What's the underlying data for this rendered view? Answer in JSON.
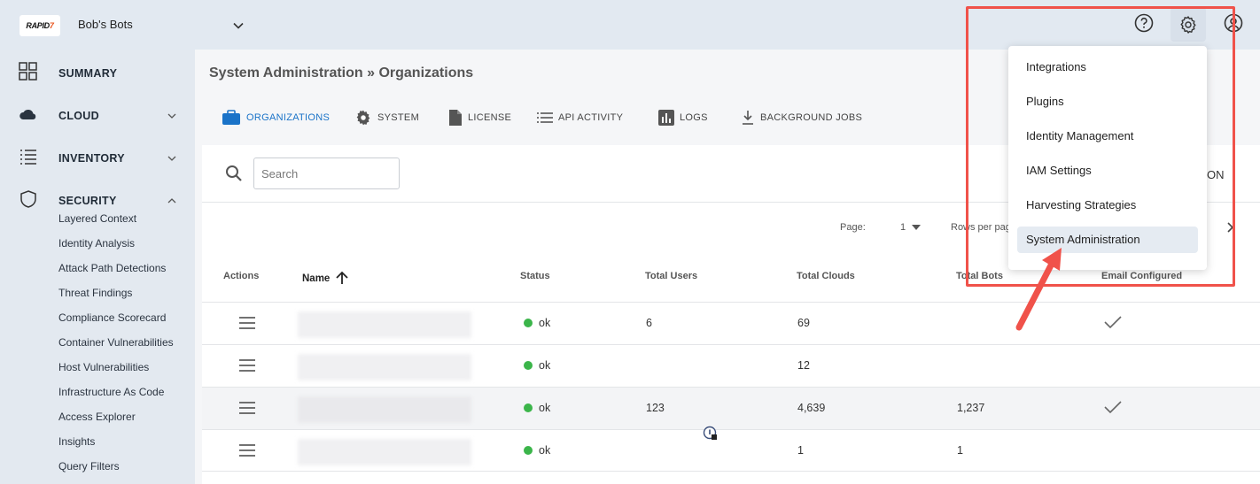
{
  "topbar": {
    "logo": {
      "prefix": "RAPID",
      "suffix": "7"
    },
    "org_name": "Bob's Bots"
  },
  "sidebar": {
    "items": [
      {
        "label": "SUMMARY"
      },
      {
        "label": "CLOUD"
      },
      {
        "label": "INVENTORY"
      },
      {
        "label": "SECURITY"
      }
    ],
    "security_subitems": [
      "Layered Context",
      "Identity Analysis",
      "Attack Path Detections",
      "Threat Findings",
      "Compliance Scorecard",
      "Container Vulnerabilities",
      "Host Vulnerabilities",
      "Infrastructure As Code",
      "Access Explorer",
      "Insights",
      "Query Filters"
    ]
  },
  "main": {
    "title": "System Administration » Organizations",
    "tabs": [
      {
        "label": "ORGANIZATIONS",
        "active": true
      },
      {
        "label": "SYSTEM"
      },
      {
        "label": "LICENSE"
      },
      {
        "label": "API ACTIVITY"
      },
      {
        "label": "LOGS"
      },
      {
        "label": "BACKGROUND JOBS"
      }
    ],
    "search": {
      "placeholder": "Search"
    },
    "toolbar_right_text": "ON",
    "pager": {
      "page_label": "Page:",
      "page_value": "1",
      "rows_label": "Rows per pag"
    },
    "table": {
      "headers": {
        "actions": "Actions",
        "name": "Name",
        "status": "Status",
        "total_users": "Total Users",
        "total_clouds": "Total Clouds",
        "total_bots": "Total Bots",
        "email_configured": "Email Configured"
      },
      "rows": [
        {
          "status": "ok",
          "users": "6",
          "clouds": "69",
          "bots": "",
          "email": true
        },
        {
          "status": "ok",
          "users": "",
          "clouds": "12",
          "bots": "",
          "email": false
        },
        {
          "status": "ok",
          "users": "123",
          "clouds": "4,639",
          "bots": "1,237",
          "email": true
        },
        {
          "status": "ok",
          "users": "",
          "clouds": "1",
          "bots": "1",
          "email": false
        }
      ]
    }
  },
  "settings_menu": {
    "items": [
      "Integrations",
      "Plugins",
      "Identity Management",
      "IAM Settings",
      "Harvesting Strategies",
      "System Administration"
    ],
    "highlighted_index": 5
  },
  "colors": {
    "accent": "#1a73c8",
    "status_ok": "#3bb54a",
    "annotation": "#f0524a"
  }
}
